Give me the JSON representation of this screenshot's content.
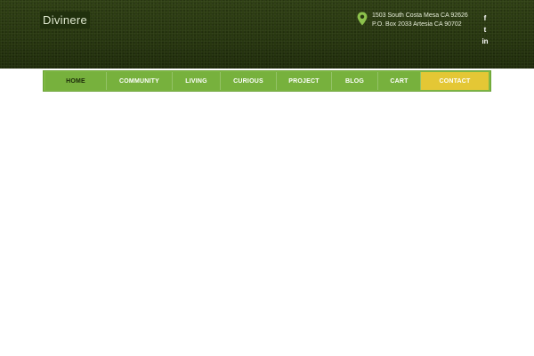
{
  "site": {
    "logo_text": "Divinere"
  },
  "contact_info": {
    "address_line1": "1503 South Costa Mesa CA 92626",
    "address_line2": "P.O. Box 2033 Artesia CA 90702",
    "icon": "map-pin-icon"
  },
  "social": [
    {
      "name": "facebook-icon",
      "glyph": "f"
    },
    {
      "name": "twitter-icon",
      "glyph": "t"
    },
    {
      "name": "linkedin-icon",
      "glyph": "in"
    }
  ],
  "nav": {
    "items": [
      {
        "label": "HOME",
        "active": true
      },
      {
        "label": "COMMUNITY"
      },
      {
        "label": "LIVING"
      },
      {
        "label": "CURIOUS"
      },
      {
        "label": "PROJECT"
      },
      {
        "label": "BLOG"
      },
      {
        "label": "CART"
      },
      {
        "label": "CONTACT",
        "highlight": true
      }
    ]
  },
  "colors": {
    "header_bg": "#2b3a12",
    "nav_green": "#77b13d",
    "contact_yellow": "#e4c735",
    "pin_green": "#8cc14c"
  }
}
